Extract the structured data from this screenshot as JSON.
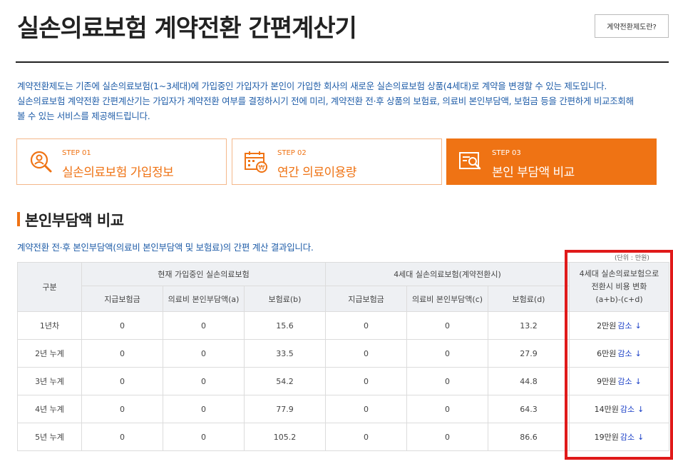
{
  "page": {
    "title": "실손의료보험 계약전환 간편계산기",
    "guide_button": "계약전환제도란?"
  },
  "intro": [
    "계약전환제도는 기존에 실손의료보험(1~3세대)에 가입중인 가입자가 본인이 가입한 회사의 새로운 실손의료보험 상품(4세대)로 계약을 변경할 수 있는 제도입니다.",
    "실손의료보험 계약전환 간편계산기는 가입자가 계약전환 여부를 결정하시기 전에 미리, 계약전환 전·후 상품의 보험료, 의료비 본인부담액, 보험금 등을 간편하게 비교조회해",
    "볼 수 있는 서비스를 제공해드립니다."
  ],
  "steps": [
    {
      "no": "STEP 01",
      "label": "실손의료보험 가입정보",
      "icon": "person-search-icon"
    },
    {
      "no": "STEP 02",
      "label": "연간 의료이용량",
      "icon": "calendar-won-icon"
    },
    {
      "no": "STEP 03",
      "label": "본인 부담액 비교",
      "icon": "document-search-icon"
    }
  ],
  "section": {
    "title": "본인부담액 비교",
    "desc": "계약전환 전·후 본인부담액(의료비 본인부담액 및 보험료)의 간편 계산 결과입니다.",
    "unit": "(단위 : 만원)"
  },
  "table": {
    "head": {
      "category": "구분",
      "current_group": "현재 가입중인 실손의료보험",
      "new_group": "4세대 실손의료보험(계약전환시)",
      "change_lines": [
        "4세대 실손의료보험으로",
        "전환시 비용 변화",
        "(a+b)-(c+d)"
      ],
      "sub": [
        "지급보험금",
        "의료비 본인부담액(a)",
        "보험료(b)",
        "지급보험금",
        "의료비 본인부담액(c)",
        "보험료(d)"
      ]
    },
    "rows": [
      {
        "label": "1년차",
        "cur_paid": "0",
        "cur_a": "0",
        "cur_b": "15.6",
        "new_paid": "0",
        "new_c": "0",
        "new_d": "13.2",
        "change_amount": "2만원",
        "change_word": "감소",
        "change_arrow": "↓"
      },
      {
        "label": "2년 누계",
        "cur_paid": "0",
        "cur_a": "0",
        "cur_b": "33.5",
        "new_paid": "0",
        "new_c": "0",
        "new_d": "27.9",
        "change_amount": "6만원",
        "change_word": "감소",
        "change_arrow": "↓"
      },
      {
        "label": "3년 누계",
        "cur_paid": "0",
        "cur_a": "0",
        "cur_b": "54.2",
        "new_paid": "0",
        "new_c": "0",
        "new_d": "44.8",
        "change_amount": "9만원",
        "change_word": "감소",
        "change_arrow": "↓"
      },
      {
        "label": "4년 누계",
        "cur_paid": "0",
        "cur_a": "0",
        "cur_b": "77.9",
        "new_paid": "0",
        "new_c": "0",
        "new_d": "64.3",
        "change_amount": "14만원",
        "change_word": "감소",
        "change_arrow": "↓"
      },
      {
        "label": "5년 누계",
        "cur_paid": "0",
        "cur_a": "0",
        "cur_b": "105.2",
        "new_paid": "0",
        "new_c": "0",
        "new_d": "86.6",
        "change_amount": "19만원",
        "change_word": "감소",
        "change_arrow": "↓"
      }
    ]
  },
  "colors": {
    "accent": "#ef7314",
    "link_blue": "#1f5da8",
    "decrease_blue": "#1a3fc7",
    "highlight_red": "#e01a1a"
  }
}
